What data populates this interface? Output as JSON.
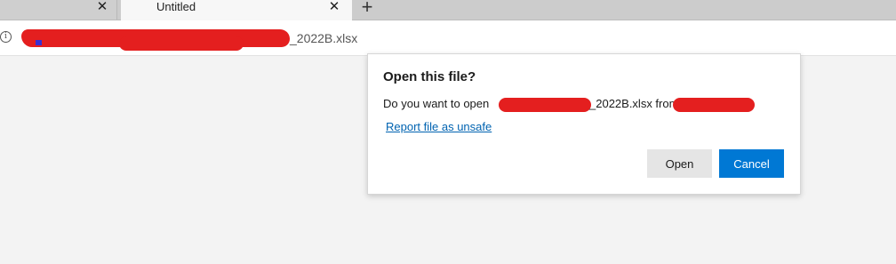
{
  "tabs": [
    {
      "label": "",
      "close_glyph": "✕"
    },
    {
      "label": "Untitled",
      "close_glyph": "✕"
    }
  ],
  "new_tab_glyph": "+",
  "address_bar": {
    "info_glyph": "i",
    "url_suffix": "_2022B.xlsx"
  },
  "dialog": {
    "title": "Open this file?",
    "message_prefix": "Do you want to open",
    "message_file_suffix": "_2022B.xlsx from",
    "report_link": "Report file as unsafe",
    "open_label": "Open",
    "cancel_label": "Cancel"
  },
  "colors": {
    "accent": "#0078d4",
    "link": "#0063b1",
    "redaction": "#e41f1f"
  },
  "icons": [
    "close-icon",
    "new-tab-icon",
    "info-icon"
  ]
}
